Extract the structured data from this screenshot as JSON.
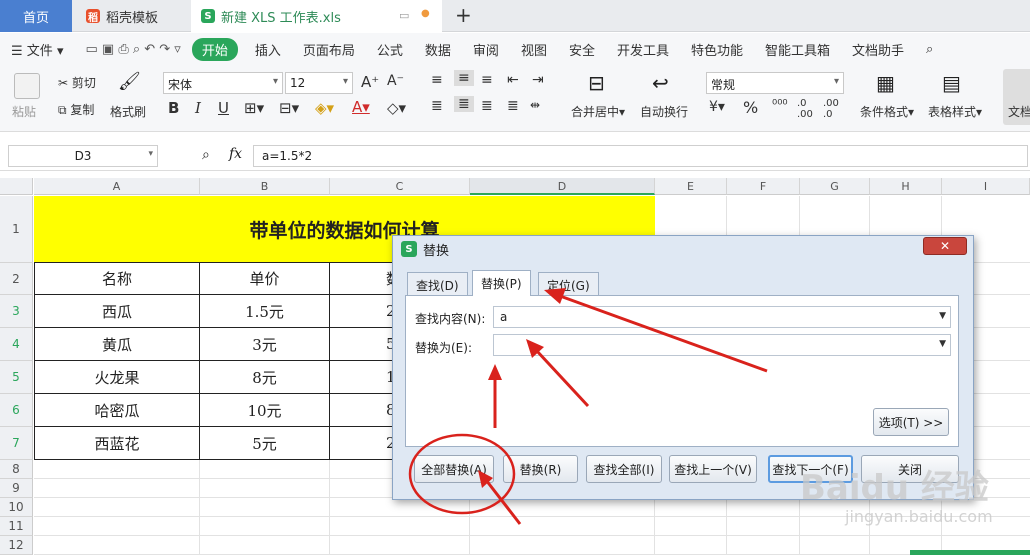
{
  "tabs": {
    "home": "首页",
    "template": "稻壳模板",
    "document": "新建 XLS 工作表.xls"
  },
  "menu": {
    "file": "文件",
    "items": [
      "开始",
      "插入",
      "页面布局",
      "公式",
      "数据",
      "审阅",
      "视图",
      "安全",
      "开发工具",
      "特色功能",
      "智能工具箱",
      "文档助手"
    ]
  },
  "ribbon": {
    "paste": "粘贴",
    "cut": "剪切",
    "copy": "复制",
    "format_brush": "格式刷",
    "font": "宋体",
    "size": "12",
    "merge": "合并居中",
    "wrap": "自动换行",
    "number_format": "常规",
    "cond_format": "条件格式",
    "table_style": "表格样式",
    "doc": "文档"
  },
  "formula_bar": {
    "cell_ref": "D3",
    "fx": "fx",
    "formula": "a=1.5*2"
  },
  "columns": [
    "A",
    "B",
    "C",
    "D",
    "E",
    "F",
    "G",
    "H",
    "I"
  ],
  "rows": [
    "1",
    "2",
    "3",
    "4",
    "5",
    "6",
    "7",
    "8",
    "9",
    "10",
    "11",
    "12"
  ],
  "sheet": {
    "title": "带单位的数据如何计算",
    "headers": [
      "名称",
      "单价",
      "数"
    ],
    "data": [
      [
        "西瓜",
        "1.5元",
        "2"
      ],
      [
        "黄瓜",
        "3元",
        "5"
      ],
      [
        "火龙果",
        "8元",
        "1"
      ],
      [
        "哈密瓜",
        "10元",
        "8"
      ],
      [
        "西蓝花",
        "5元",
        "2"
      ]
    ]
  },
  "dialog": {
    "title": "替换",
    "tab_find": "查找(D)",
    "tab_replace": "替换(P)",
    "tab_goto": "定位(G)",
    "find_label": "查找内容(N):",
    "find_value": "a",
    "replace_label": "替换为(E):",
    "replace_value": "",
    "options": "选项(T) >>",
    "btn_replace_all": "全部替换(A)",
    "btn_replace": "替换(R)",
    "btn_find_all": "查找全部(I)",
    "btn_find_prev": "查找上一个(V)",
    "btn_find_next": "查找下一个(F)",
    "btn_close": "关闭"
  },
  "watermark": {
    "brand": "Baidu 经验",
    "url": "jingyan.baidu.com"
  },
  "colors": {
    "accent": "#2aa65b",
    "title_fill": "#ffff00",
    "annotation": "#d9221c"
  }
}
